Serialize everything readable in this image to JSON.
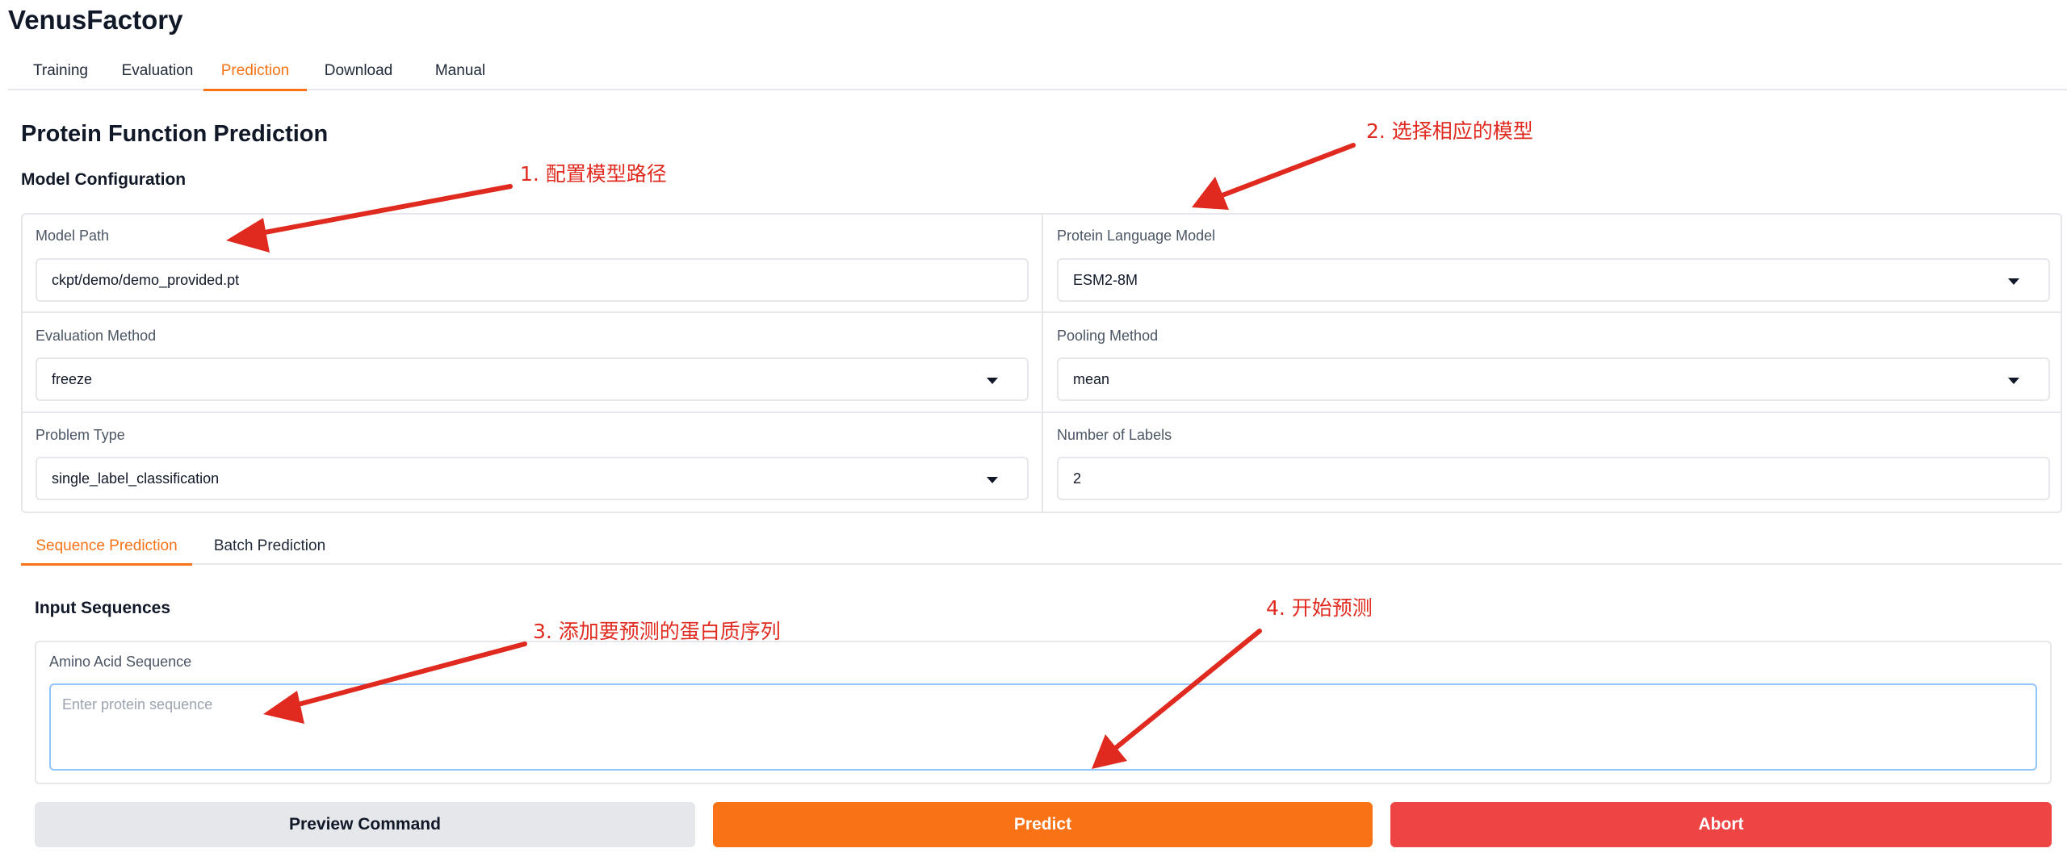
{
  "app": {
    "title": "VenusFactory"
  },
  "main_tabs": [
    {
      "label": "Training"
    },
    {
      "label": "Evaluation"
    },
    {
      "label": "Prediction",
      "active": true
    },
    {
      "label": "Download"
    },
    {
      "label": "Manual"
    }
  ],
  "page": {
    "title": "Protein Function Prediction",
    "config_title": "Model Configuration"
  },
  "config": {
    "model_path": {
      "label": "Model Path",
      "value": "ckpt/demo/demo_provided.pt"
    },
    "plm": {
      "label": "Protein Language Model",
      "value": "ESM2-8M"
    },
    "eval_method": {
      "label": "Evaluation Method",
      "value": "freeze"
    },
    "pooling": {
      "label": "Pooling Method",
      "value": "mean"
    },
    "problem_type": {
      "label": "Problem Type",
      "value": "single_label_classification"
    },
    "num_labels": {
      "label": "Number of Labels",
      "value": "2"
    }
  },
  "sub_tabs": [
    {
      "label": "Sequence Prediction",
      "active": true
    },
    {
      "label": "Batch Prediction"
    }
  ],
  "sequence": {
    "section_title": "Input Sequences",
    "label": "Amino Acid Sequence",
    "placeholder": "Enter protein sequence",
    "value": ""
  },
  "buttons": {
    "preview": "Preview Command",
    "predict": "Predict",
    "abort": "Abort"
  },
  "annotations": {
    "step1": "1. 配置模型路径",
    "step2": "2. 选择相应的模型",
    "step3": "3. 添加要预测的蛋白质序列",
    "step4": "4. 开始预测"
  },
  "colors": {
    "accent": "#f97316",
    "danger": "#ef4444",
    "annotation": "#e02a1f",
    "secondary_button": "#e5e7eb"
  },
  "icons": {
    "dropdown": "chevron-down-icon",
    "annotation_arrow": "arrow-icon"
  }
}
